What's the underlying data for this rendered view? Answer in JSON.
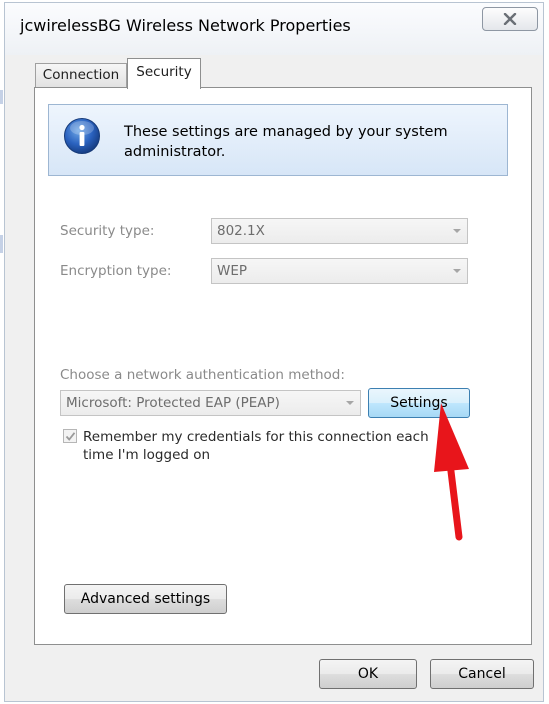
{
  "window": {
    "title": "jcwirelessBG Wireless Network Properties"
  },
  "tabs": [
    {
      "label": "Connection",
      "active": false
    },
    {
      "label": "Security",
      "active": true
    }
  ],
  "info": {
    "icon": "info-icon",
    "message": "These settings are managed by your system administrator."
  },
  "security": {
    "security_type_label": "Security type:",
    "security_type_value": "802.1X",
    "encryption_type_label": "Encryption type:",
    "encryption_type_value": "WEP"
  },
  "authentication": {
    "method_label": "Choose a network authentication method:",
    "method_value": "Microsoft: Protected EAP (PEAP)",
    "settings_button": "Settings",
    "remember_credentials_label": "Remember my credentials for this connection each time I'm logged on",
    "remember_credentials_checked": true
  },
  "advanced_settings_button": "Advanced settings",
  "footer": {
    "ok_label": "OK",
    "cancel_label": "Cancel"
  },
  "colors": {
    "annotation_arrow": "#e8151b",
    "info_background": "#dce9f8",
    "settings_button_highlight": "#bee6fd"
  }
}
